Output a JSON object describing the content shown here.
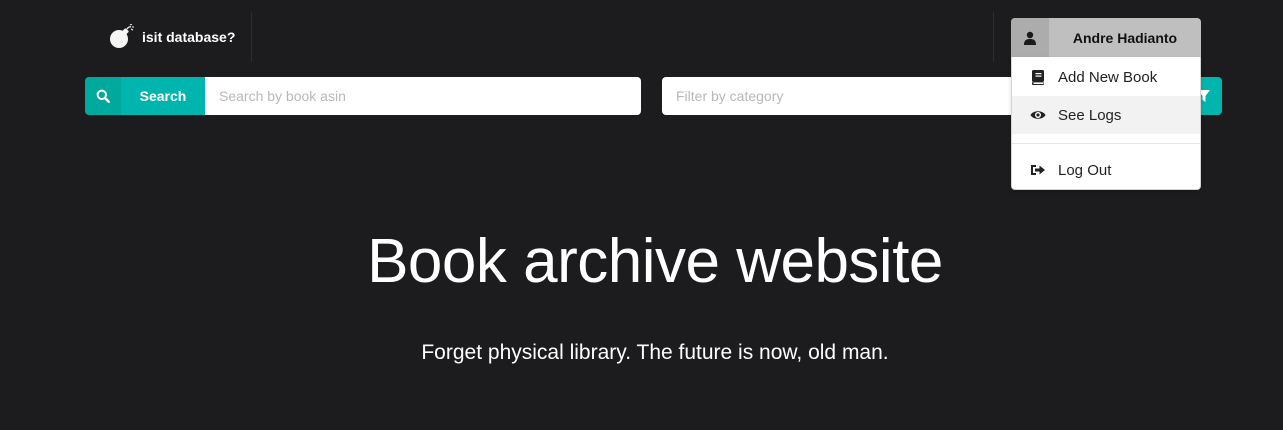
{
  "navbar": {
    "brand_label": "isit database?",
    "brand_icon": "bomb-icon",
    "user": {
      "name": "Andre Hadianto",
      "icon": "user-icon"
    }
  },
  "search": {
    "button_label": "Search",
    "placeholder": "Search by book asin",
    "value": "",
    "icon": "search-icon"
  },
  "filter": {
    "placeholder": "Filter by category",
    "value": "",
    "icon": "filter-icon"
  },
  "dropdown": {
    "items": [
      {
        "label": "Add New Book",
        "icon": "book-icon"
      },
      {
        "label": "See Logs",
        "icon": "eye-icon",
        "active": true
      },
      {
        "label": "Log Out",
        "icon": "sign-out-icon"
      }
    ]
  },
  "hero": {
    "title": "Book archive website",
    "subtitle": "Forget physical library. The future is now, old man."
  },
  "colors": {
    "background": "#1c1c1e",
    "accent": "#00b5ad",
    "accent_dark": "#00a99d",
    "user_button": "#bfbfbf"
  }
}
